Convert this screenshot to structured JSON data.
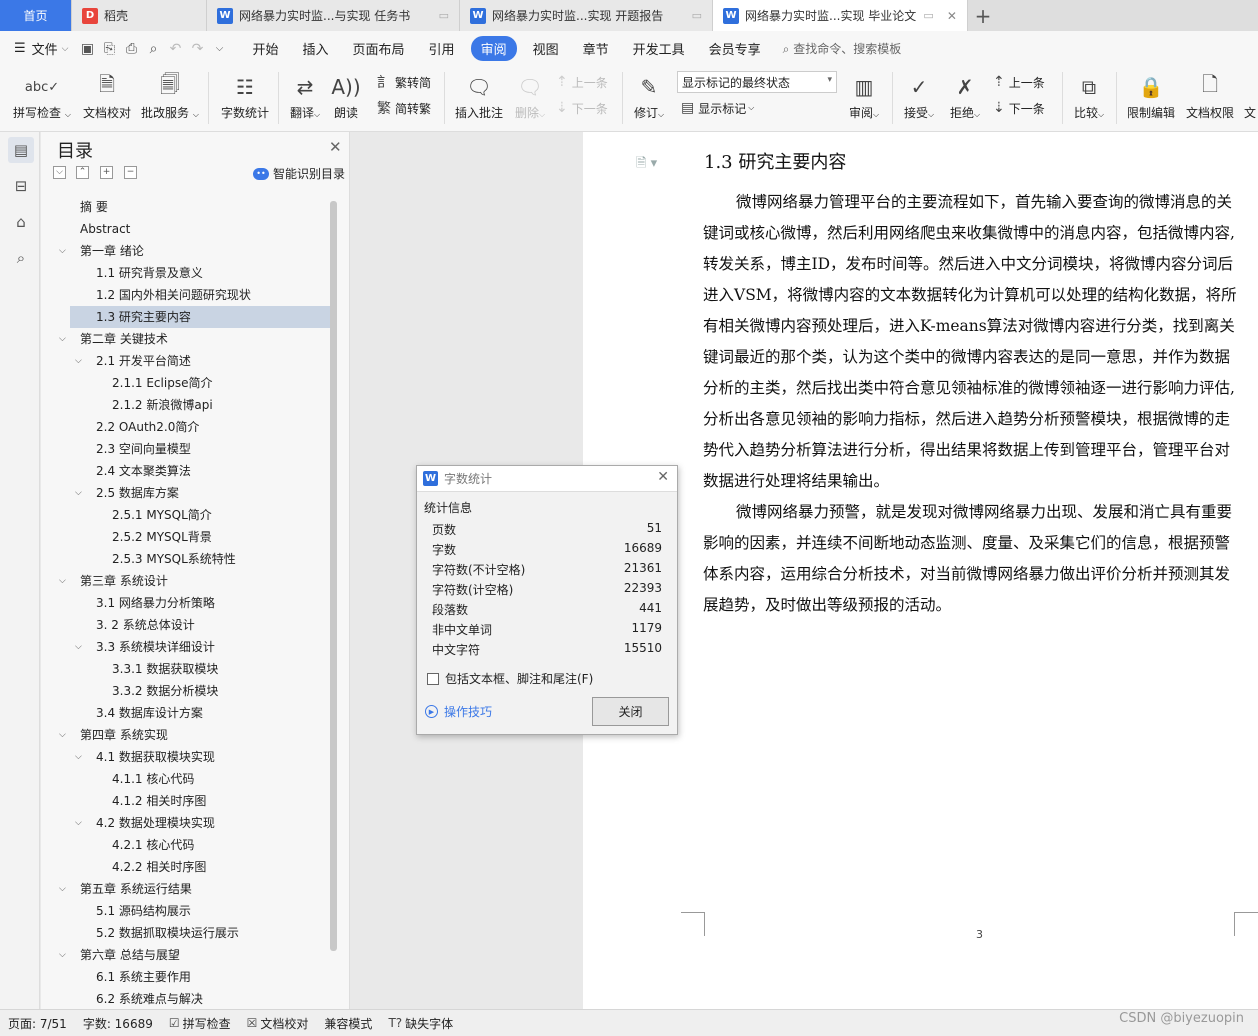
{
  "tabs": {
    "home": "首页",
    "wps": "稻壳",
    "doc1": "网络暴力实时监...与实现 任务书",
    "doc2": "网络暴力实时监...实现 开题报告",
    "doc3": "网络暴力实时监...实现 毕业论文"
  },
  "menu": {
    "file": "文件",
    "items": [
      "开始",
      "插入",
      "页面布局",
      "引用",
      "审阅",
      "视图",
      "章节",
      "开发工具",
      "会员专享"
    ],
    "active": "审阅",
    "search": "查找命令、搜索模板"
  },
  "ribbon": {
    "spellcheck": "拼写检查",
    "doc_proof": "文档校对",
    "batch_service": "批改服务",
    "word_count": "字数统计",
    "translate": "翻译",
    "read_aloud": "朗读",
    "trad_simp": "繁转简",
    "simp_trad": "简转繁",
    "insert_comment": "插入批注",
    "delete": "删除",
    "prev_comment": "上一条",
    "next_comment": "下一条",
    "revise": "修订",
    "markup_state": "显示标记的最终状态",
    "show_markup": "显示标记",
    "review": "审阅",
    "accept": "接受",
    "reject": "拒绝",
    "prev_change": "上一条",
    "next_change": "下一条",
    "compare": "比较",
    "restrict_edit": "限制编辑",
    "doc_permission": "文档权限",
    "cut_off": "文"
  },
  "toc": {
    "title": "目录",
    "smart_label": "智能识别目录",
    "items": [
      {
        "label": "摘  要",
        "level": 1,
        "arrow": ""
      },
      {
        "label": "Abstract",
        "level": 1,
        "arrow": ""
      },
      {
        "label": "第一章 绪论",
        "level": 1,
        "arrow": "⌵"
      },
      {
        "label": "1.1 研究背景及意义",
        "level": 2,
        "arrow": ""
      },
      {
        "label": "1.2 国内外相关问题研究现状",
        "level": 2,
        "arrow": ""
      },
      {
        "label": "1.3 研究主要内容",
        "level": 2,
        "arrow": ""
      },
      {
        "label": "第二章 关键技术",
        "level": 1,
        "arrow": "⌵"
      },
      {
        "label": "2.1 开发平台简述",
        "level": 2,
        "arrow": "⌵"
      },
      {
        "label": "2.1.1 Eclipse简介",
        "level": 3,
        "arrow": ""
      },
      {
        "label": "2.1.2 新浪微博api",
        "level": 3,
        "arrow": ""
      },
      {
        "label": "2.2 OAuth2.0简介",
        "level": 2,
        "arrow": ""
      },
      {
        "label": "2.3 空间向量模型",
        "level": 2,
        "arrow": ""
      },
      {
        "label": "2.4 文本聚类算法",
        "level": 2,
        "arrow": ""
      },
      {
        "label": "2.5 数据库方案",
        "level": 2,
        "arrow": "⌵"
      },
      {
        "label": "2.5.1 MYSQL简介",
        "level": 3,
        "arrow": ""
      },
      {
        "label": "2.5.2 MYSQL背景",
        "level": 3,
        "arrow": ""
      },
      {
        "label": "2.5.3 MYSQL系统特性",
        "level": 3,
        "arrow": ""
      },
      {
        "label": "第三章 系统设计",
        "level": 1,
        "arrow": "⌵"
      },
      {
        "label": "3.1 网络暴力分析策略",
        "level": 2,
        "arrow": ""
      },
      {
        "label": "3. 2 系统总体设计",
        "level": 2,
        "arrow": ""
      },
      {
        "label": "3.3 系统模块详细设计",
        "level": 2,
        "arrow": "⌵"
      },
      {
        "label": "3.3.1 数据获取模块",
        "level": 3,
        "arrow": ""
      },
      {
        "label": "3.3.2 数据分析模块",
        "level": 3,
        "arrow": ""
      },
      {
        "label": "3.4 数据库设计方案",
        "level": 2,
        "arrow": ""
      },
      {
        "label": "第四章 系统实现",
        "level": 1,
        "arrow": "⌵"
      },
      {
        "label": "4.1 数据获取模块实现",
        "level": 2,
        "arrow": "⌵"
      },
      {
        "label": "4.1.1 核心代码",
        "level": 3,
        "arrow": ""
      },
      {
        "label": "4.1.2 相关时序图",
        "level": 3,
        "arrow": ""
      },
      {
        "label": "4.2 数据处理模块实现",
        "level": 2,
        "arrow": "⌵"
      },
      {
        "label": "4.2.1 核心代码",
        "level": 3,
        "arrow": ""
      },
      {
        "label": "4.2.2 相关时序图",
        "level": 3,
        "arrow": ""
      },
      {
        "label": "第五章 系统运行结果",
        "level": 1,
        "arrow": "⌵"
      },
      {
        "label": "5.1 源码结构展示",
        "level": 2,
        "arrow": ""
      },
      {
        "label": "5.2 数据抓取模块运行展示",
        "level": 2,
        "arrow": ""
      },
      {
        "label": "第六章 总结与展望",
        "level": 1,
        "arrow": "⌵"
      },
      {
        "label": "6.1 系统主要作用",
        "level": 2,
        "arrow": ""
      },
      {
        "label": "6.2 系统难点与解决",
        "level": 2,
        "arrow": ""
      }
    ],
    "selected_index": 5
  },
  "document": {
    "heading": "1.3 研究主要内容",
    "lines": [
      "微博网络暴力管理平台的主要流程如下，首先输入要查询的微博消息的关",
      "键词或核心微博，然后利用网络爬虫来收集微博中的消息内容，包括微博内容,",
      "转发关系，博主ID，发布时间等。然后进入中文分词模块，将微博内容分词后",
      "进入VSM，将微博内容的文本数据转化为计算机可以处理的结构化数据，将所",
      "有相关微博内容预处理后，进入K-means算法对微博内容进行分类，找到离关",
      "键词最近的那个类，认为这个类中的微博内容表达的是同一意思，并作为数据",
      "分析的主类，然后找出类中符合意见领袖标准的微博领袖逐一进行影响力评估,",
      "分析出各意见领袖的影响力指标，然后进入趋势分析预警模块，根据微博的走",
      "势代入趋势分析算法进行分析，得出结果将数据上传到管理平台，管理平台对",
      "数据进行处理将结果输出。",
      "微博网络暴力预警，就是发现对微博网络暴力出现、发展和消亡具有重要",
      "影响的因素，并连续不间断地动态监测、度量、及采集它们的信息，根据预警",
      "体系内容，运用综合分析技术，对当前微博网络暴力做出评价分析并预测其发",
      "展趋势，及时做出等级预报的活动。"
    ],
    "page_number": "3"
  },
  "dialog": {
    "title": "字数统计",
    "section": "统计信息",
    "rows": [
      {
        "label": "页数",
        "value": "51"
      },
      {
        "label": "字数",
        "value": "16689"
      },
      {
        "label": "字符数(不计空格)",
        "value": "21361"
      },
      {
        "label": "字符数(计空格)",
        "value": "22393"
      },
      {
        "label": "段落数",
        "value": "441"
      },
      {
        "label": "非中文单词",
        "value": "1179"
      },
      {
        "label": "中文字符",
        "value": "15510"
      }
    ],
    "checkbox_label": "包括文本框、脚注和尾注(F)",
    "tips": "操作技巧",
    "close": "关闭"
  },
  "status": {
    "page": "页面: 7/51",
    "words": "字数: 16689",
    "spell": "拼写检查",
    "proof": "文档校对",
    "compat": "兼容模式",
    "missing_font": "缺失字体"
  },
  "watermark": "CSDN @biyezuopin",
  "colors": {
    "accent": "#3b78e7",
    "toc_selected": "#c9d4e3"
  }
}
